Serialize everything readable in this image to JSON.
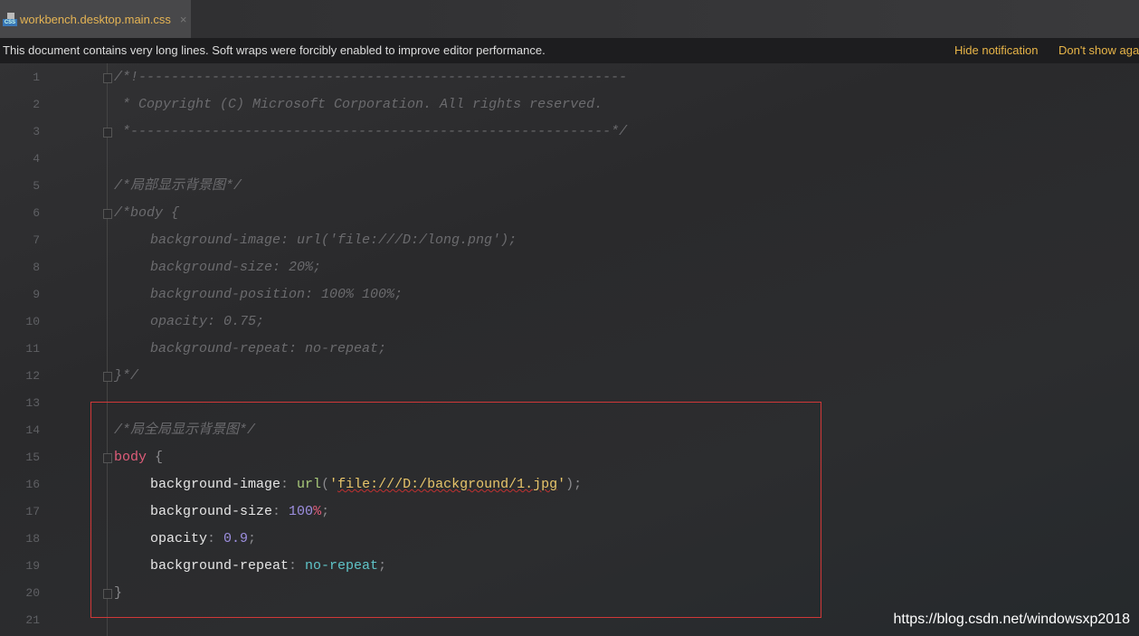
{
  "tab": {
    "filename": "workbench.desktop.main.css",
    "icon": "css-file-icon",
    "close": "×"
  },
  "notification": {
    "message": "This document contains very long lines. Soft wraps were forcibly enabled to improve editor performance.",
    "hide": "Hide notification",
    "dont_show": "Don't show again"
  },
  "lines": [
    {
      "n": "1",
      "indent": 0,
      "fold": true,
      "tokens": [
        {
          "t": "comment",
          "v": "/*!------------------------------------------------------------"
        }
      ]
    },
    {
      "n": "2",
      "indent": 0,
      "tokens": [
        {
          "t": "comment",
          "v": " * Copyright (C) Microsoft Corporation. All rights reserved."
        }
      ]
    },
    {
      "n": "3",
      "indent": 0,
      "fold": true,
      "tokens": [
        {
          "t": "comment",
          "v": " *-----------------------------------------------------------*/"
        }
      ]
    },
    {
      "n": "4",
      "indent": 0,
      "tokens": []
    },
    {
      "n": "5",
      "indent": 0,
      "tokens": [
        {
          "t": "comment",
          "v": "/*局部显示背景图*/"
        }
      ]
    },
    {
      "n": "6",
      "indent": 0,
      "fold": true,
      "tokens": [
        {
          "t": "comment",
          "v": "/*body {"
        }
      ]
    },
    {
      "n": "7",
      "indent": 1,
      "tokens": [
        {
          "t": "comment",
          "v": "background-image: url('file:///D:/long.png');"
        }
      ]
    },
    {
      "n": "8",
      "indent": 1,
      "tokens": [
        {
          "t": "comment",
          "v": "background-size: 20%;"
        }
      ]
    },
    {
      "n": "9",
      "indent": 1,
      "tokens": [
        {
          "t": "comment",
          "v": "background-position: 100% 100%;"
        }
      ]
    },
    {
      "n": "10",
      "indent": 1,
      "tokens": [
        {
          "t": "comment",
          "v": "opacity: 0.75;"
        }
      ]
    },
    {
      "n": "11",
      "indent": 1,
      "tokens": [
        {
          "t": "comment",
          "v": "background-repeat: no-repeat;"
        }
      ]
    },
    {
      "n": "12",
      "indent": 0,
      "fold": true,
      "tokens": [
        {
          "t": "comment",
          "v": "}*/"
        }
      ]
    },
    {
      "n": "13",
      "indent": 0,
      "tokens": []
    },
    {
      "n": "14",
      "indent": 0,
      "tokens": [
        {
          "t": "comment",
          "v": "/*局全局显示背景图*/"
        }
      ]
    },
    {
      "n": "15",
      "indent": 0,
      "fold": true,
      "tokens": [
        {
          "t": "selector",
          "v": "body"
        },
        {
          "t": "punct",
          "v": " {"
        }
      ]
    },
    {
      "n": "16",
      "indent": 1,
      "tokens": [
        {
          "t": "prop",
          "v": "background-image"
        },
        {
          "t": "punct",
          "v": ": "
        },
        {
          "t": "func",
          "v": "url"
        },
        {
          "t": "punct",
          "v": "("
        },
        {
          "t": "quote",
          "v": "'"
        },
        {
          "t": "string",
          "v": "file:///D:/background/1.jpg"
        },
        {
          "t": "quote",
          "v": "'"
        },
        {
          "t": "punct",
          "v": ");"
        }
      ]
    },
    {
      "n": "17",
      "indent": 1,
      "tokens": [
        {
          "t": "prop",
          "v": "background-size"
        },
        {
          "t": "punct",
          "v": ": "
        },
        {
          "t": "number",
          "v": "100"
        },
        {
          "t": "selector",
          "v": "%"
        },
        {
          "t": "punct",
          "v": ";"
        }
      ]
    },
    {
      "n": "18",
      "indent": 1,
      "tokens": [
        {
          "t": "prop",
          "v": "opacity"
        },
        {
          "t": "punct",
          "v": ": "
        },
        {
          "t": "number",
          "v": "0.9"
        },
        {
          "t": "punct",
          "v": ";"
        }
      ]
    },
    {
      "n": "19",
      "indent": 1,
      "tokens": [
        {
          "t": "prop",
          "v": "background-repeat"
        },
        {
          "t": "punct",
          "v": ": "
        },
        {
          "t": "value",
          "v": "no-repeat"
        },
        {
          "t": "punct",
          "v": ";"
        }
      ]
    },
    {
      "n": "20",
      "indent": 0,
      "fold": true,
      "tokens": [
        {
          "t": "punct",
          "v": "}"
        }
      ]
    },
    {
      "n": "21",
      "indent": 0,
      "tokens": []
    }
  ],
  "watermark": "https://blog.csdn.net/windowsxp2018"
}
